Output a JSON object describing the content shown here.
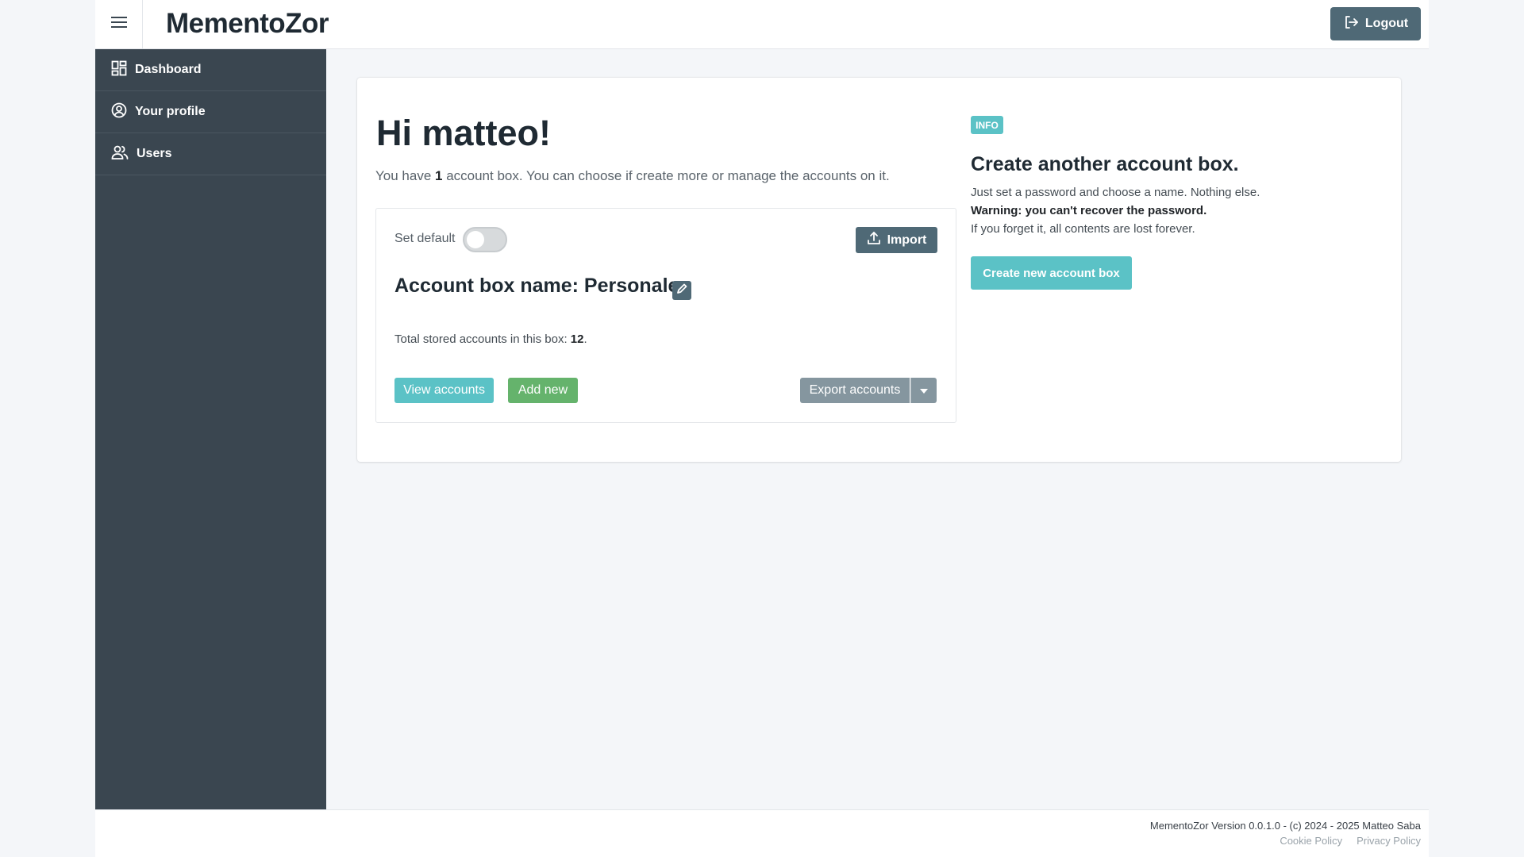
{
  "app": {
    "brand": "MementoZor"
  },
  "header": {
    "logout_label": "Logout"
  },
  "sidebar": {
    "items": [
      {
        "label": "Dashboard",
        "icon": "dashboard-icon"
      },
      {
        "label": "Your profile",
        "icon": "user-circle-icon"
      },
      {
        "label": "Users",
        "icon": "users-icon"
      }
    ]
  },
  "main": {
    "greeting": "Hi matteo!",
    "intro_prefix": "You have ",
    "intro_count": "1",
    "intro_suffix": " account box. You can choose if create more or manage the accounts on it.",
    "box": {
      "set_default_label": "Set default",
      "set_default_on": false,
      "import_label": "Import",
      "name_label": "Account box name: Personale",
      "total_prefix": "Total stored accounts in this box: ",
      "total_count": "12",
      "total_suffix": ".",
      "view_label": "View accounts",
      "add_label": "Add new",
      "export_label": "Export accounts"
    },
    "info": {
      "badge": "INFO",
      "title": "Create another account box.",
      "line1": "Just set a password and choose a name. Nothing else.",
      "warning": "Warning: you can't recover the password.",
      "line3": "If you forget it, all contents are lost forever.",
      "create_label": "Create new account box"
    }
  },
  "footer": {
    "version": "MementoZor Version 0.0.1.0 - (c) 2024 - 2025 Matteo Saba",
    "cookie_policy": "Cookie Policy",
    "privacy_policy": "Privacy Policy"
  },
  "colors": {
    "sidebar_bg": "#3a4650",
    "primary_dark": "#4f6976",
    "info": "#5bc2c6",
    "success": "#65b36c",
    "secondary": "#85969f"
  }
}
